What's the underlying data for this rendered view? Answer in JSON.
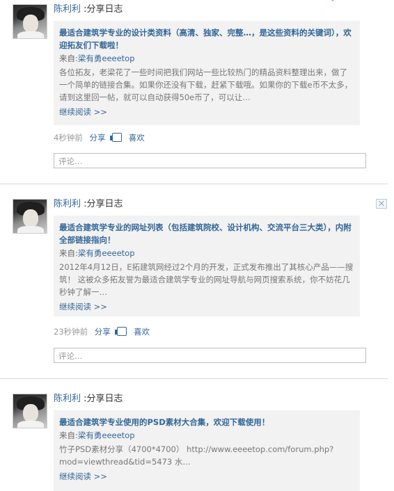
{
  "feed": [
    {
      "user": "陈利利",
      "action": ":分享日志",
      "title": "最适合建筑学专业的设计类资料（高清、独家、完整…，是这些资料的关键词），欢迎拓友们下载啦！",
      "source_label": "来自:",
      "source_name": "梁有勇eeeetop",
      "excerpt": "各位拓友，老梁花了一些时间把我们网站一些比较热门的精品资料整理出来，做了一个简单的链接合集。如果你还没有下载，赶紧下载哦。如果你的下载e币不太多，请到这里回一帖，就可以自动获得50e币了，可以让…",
      "read_more": "继续阅读 >>",
      "time": "4秒钟前",
      "share": "分享",
      "like": "喜欢",
      "comment_placeholder": "评论…"
    },
    {
      "user": "陈利利",
      "action": ":分享日志",
      "title": "最适合建筑学专业的网址列表（包括建筑院校、设计机构、交流平台三大类），内附全部链接指向！",
      "source_label": "来自:",
      "source_name": "梁有勇eeeetop",
      "excerpt": "2012年4月12日，E拓建筑网经过2个月的开发，正式发布推出了其核心产品——搜筑！ 这被众多拓友誉为最适合建筑学专业的网址导航与网页搜索系统，你不妨花几秒钟了解一…",
      "read_more": "继续阅读 >>",
      "time": "23秒钟前",
      "share": "分享",
      "like": "喜欢",
      "comment_placeholder": "评论…"
    },
    {
      "user": "陈利利",
      "action": ":分享日志",
      "title": "最适合建筑学专业使用的PSD素材大合集，欢迎下载使用！",
      "source_label": "来自:",
      "source_name": "梁有勇eeeetop",
      "excerpt": "竹子PSD素材分享（4700*4700） http://www.eeeetop.com/forum.php?mod=viewthread&tid=5473 水…",
      "read_more": "继续阅读 >>"
    }
  ]
}
